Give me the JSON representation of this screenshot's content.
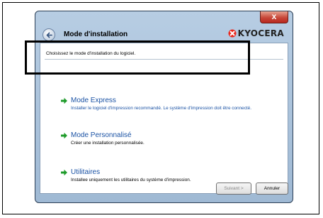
{
  "window": {
    "title": "Mode d'installation",
    "close_label": "x",
    "brand": "KYOCERA",
    "brand_color": "#e8261c"
  },
  "main": {
    "instruction": "Choisissez le mode d'installation du logiciel.",
    "options": [
      {
        "title": "Mode Express",
        "description": "Installer le logiciel d'impression recommandé. Le système d'impression doit être connecté.",
        "selected": true
      },
      {
        "title": "Mode Personnalisé",
        "description": "Créer une installation personnalisée.",
        "selected": false
      },
      {
        "title": "Utilitaires",
        "description": "Installee uniquement les utilitaires du système d'impression.",
        "selected": false
      }
    ]
  },
  "footer": {
    "next_label": "Suivant >",
    "cancel_label": "Annuler"
  },
  "colors": {
    "option_title": "#1a52a4",
    "option_desc": "#1a52a4",
    "arrow": "#1e9b2a"
  },
  "icons": {
    "back": "back-arrow-icon",
    "option": "green-arrow-icon"
  }
}
